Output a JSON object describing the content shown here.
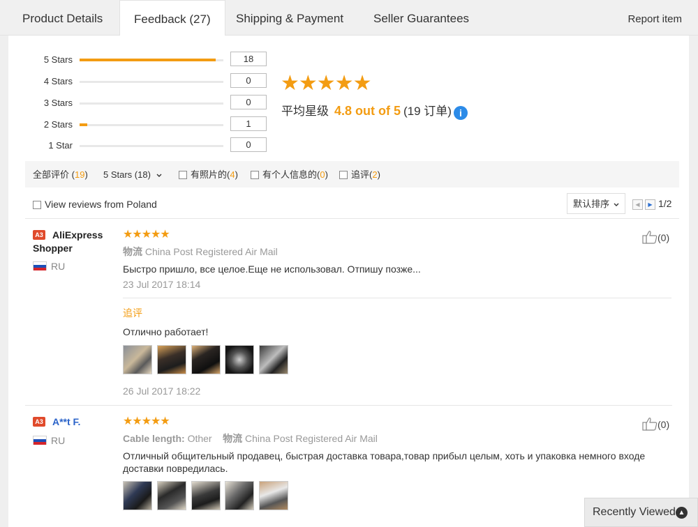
{
  "tabs": [
    {
      "label": "Product Details"
    },
    {
      "label": "Feedback (27)"
    },
    {
      "label": "Shipping & Payment"
    },
    {
      "label": "Seller Guarantees"
    }
  ],
  "report_label": "Report item",
  "rating_summary": {
    "rows": [
      {
        "label": "5 Stars",
        "count": "18",
        "fraction": 0.947
      },
      {
        "label": "4 Stars",
        "count": "0",
        "fraction": 0
      },
      {
        "label": "3 Stars",
        "count": "0",
        "fraction": 0
      },
      {
        "label": "2 Stars",
        "count": "1",
        "fraction": 0.053
      },
      {
        "label": "1 Star",
        "count": "0",
        "fraction": 0
      }
    ],
    "stars": "★★★★★",
    "avg_label": "平均星级",
    "avg_score": "4.8 out of 5",
    "avg_orders": "(19 订单)",
    "info_glyph": "i",
    "colors": {
      "accent": "#f39c12",
      "info": "#2c8be8"
    }
  },
  "filters": {
    "all_label": "全部评价",
    "all_count": "19",
    "stars_select": "5 Stars (18)",
    "with_photos_label": "有照片的",
    "with_photos_count": "4",
    "personal_info_label": "有个人信息的",
    "personal_info_count": "0",
    "followup_label": "追评",
    "followup_count": "2"
  },
  "poland_label": "View reviews from Poland",
  "sort_label": "默认排序",
  "pagination": {
    "text": "1/2",
    "prev_glyph": "◀",
    "next_glyph": "▶"
  },
  "reviews": [
    {
      "badge": "A3",
      "user": "AliExpress Shopper",
      "country": "RU",
      "stars": "★★★★★",
      "logistics_label": "物流",
      "logistics": "China Post Registered Air Mail",
      "text": "Быстро пришло, все целое.Еще не использовал. Отпишу позже...",
      "date": "23 Jul 2017 18:14",
      "followup_label": "追评",
      "followup_text": "Отлично работает!",
      "followup_date": "26 Jul 2017 18:22",
      "helpful": "(0)"
    },
    {
      "badge": "A3",
      "user": "A**t F.",
      "country": "RU",
      "stars": "★★★★★",
      "option_label": "Cable length:",
      "option_value": "Other",
      "logistics_label": "物流",
      "logistics": "China Post Registered Air Mail",
      "text": "Отличный общительный продавец, быстрая доставка товара,товар прибыл целым, хоть и упаковка немного входе доставки повредилась.",
      "helpful": "(0)"
    }
  ],
  "recently_viewed": "Recently Viewed",
  "recently_viewed_glyph": "▲"
}
